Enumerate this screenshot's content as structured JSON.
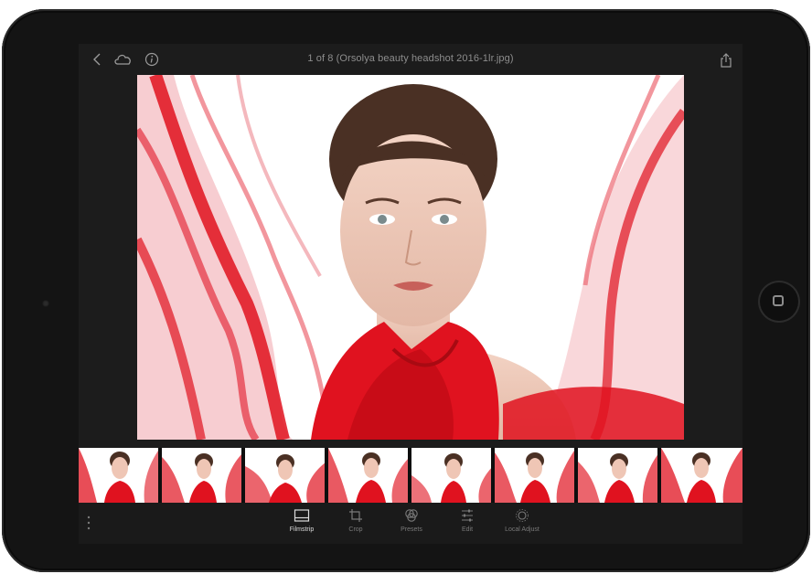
{
  "header": {
    "title": "1 of 8 (Orsolya beauty headshot 2016-1lr.jpg)"
  },
  "filmstrip": {
    "count": 8,
    "selected_index": 0
  },
  "toolbar": {
    "tools": [
      {
        "label": "Filmstrip",
        "icon": "filmstrip-icon",
        "active": true
      },
      {
        "label": "Crop",
        "icon": "crop-icon",
        "active": false
      },
      {
        "label": "Presets",
        "icon": "presets-icon",
        "active": false
      },
      {
        "label": "Edit",
        "icon": "edit-sliders-icon",
        "active": false
      },
      {
        "label": "Local Adjust",
        "icon": "local-adjust-icon",
        "active": false
      }
    ]
  },
  "colors": {
    "accent": "#e0121f",
    "background": "#1c1c1c",
    "device": "#141414"
  }
}
